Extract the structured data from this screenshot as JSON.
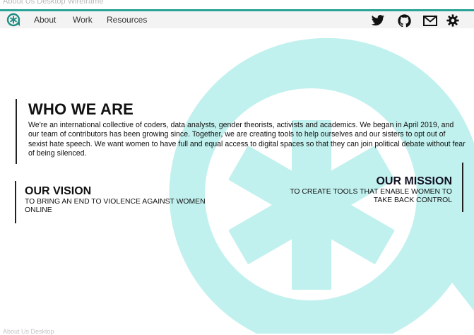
{
  "frame": {
    "title": "About Us Desktop Wireframe",
    "footer_label": "About Us Desktop"
  },
  "nav": {
    "links": [
      {
        "label": "About"
      },
      {
        "label": "Work"
      },
      {
        "label": "Resources"
      }
    ],
    "icons": [
      "twitter-icon",
      "github-icon",
      "mail-icon",
      "settings-icon"
    ]
  },
  "who_we_are": {
    "title": "WHO WE ARE",
    "body": "We're an international collective of coders, data analysts, gender theorists, activists and academics. We began in April 2019, and our team of contributors has been growing since. Together, we are creating tools to help ourselves and our sisters to opt out  of sexist hate speech. We want women to have full and equal access to digital spaces so that they can join political debate without fear of being silenced."
  },
  "vision": {
    "title": "OUR VISION",
    "text": "TO BRING AN END TO VIOLENCE AGAINST WOMEN ONLINE"
  },
  "mission": {
    "title": "OUR MISSION",
    "text": "TO CREATE TOOLS THAT ENABLE WOMEN TO TAKE BACK CONTROL"
  },
  "colors": {
    "accent": "#2aa398",
    "watermark": "#c1f1ee",
    "navbar_bg": "#f3f3f3",
    "text": "#111111"
  }
}
